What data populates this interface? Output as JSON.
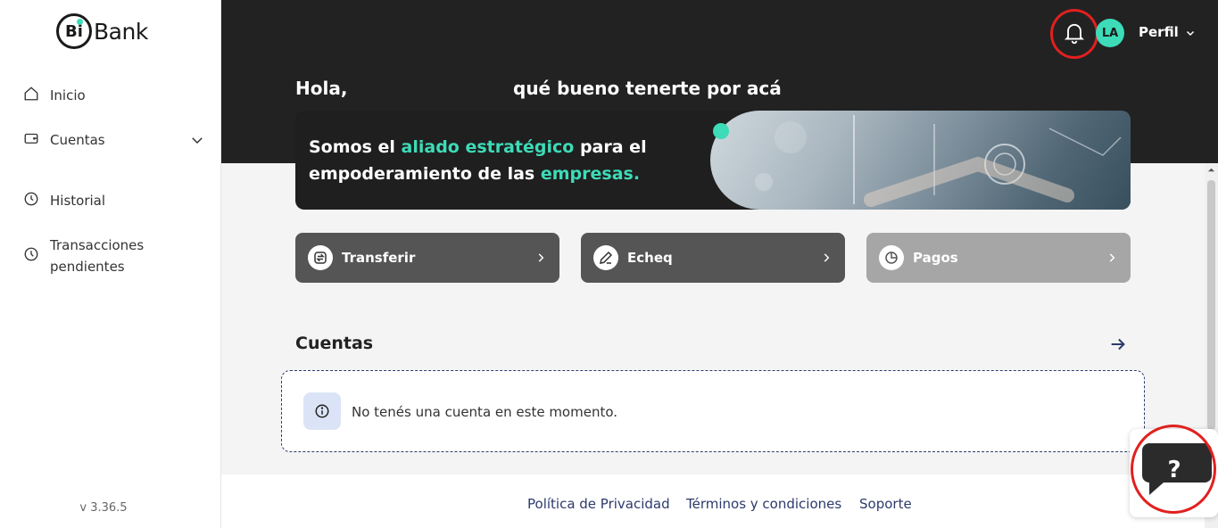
{
  "brand": {
    "logo_mark": "Bi",
    "logo_text": "Bank"
  },
  "sidebar": {
    "items": [
      {
        "label": "Inicio",
        "icon": "home-icon"
      },
      {
        "label": "Cuentas",
        "icon": "wallet-icon"
      },
      {
        "label": "Historial",
        "icon": "history-icon"
      },
      {
        "label_line1": "Transacciones",
        "label_line2": "pendientes",
        "icon": "clock-icon"
      }
    ],
    "version": "v 3.36.5"
  },
  "header": {
    "avatar_initials": "LA",
    "profile_label": "Perfil",
    "greeting_hello": "Hola,",
    "greeting_rest": "qué bueno tenerte por acá"
  },
  "banner": {
    "line1_a": "Somos el ",
    "line1_accent": "aliado estratégico",
    "line1_b": " para el",
    "line2_a": "empoderamiento de las ",
    "line2_accent": "empresas."
  },
  "actions": [
    {
      "label": "Transferir",
      "icon": "transfer-icon",
      "enabled": true
    },
    {
      "label": "Echeq",
      "icon": "pen-icon",
      "enabled": true
    },
    {
      "label": "Pagos",
      "icon": "pie-chart-icon",
      "enabled": false
    }
  ],
  "accounts": {
    "title": "Cuentas",
    "empty_message": "No tenés una cuenta en este momento."
  },
  "footer": {
    "links": [
      "Política de Privacidad",
      "Términos y condiciones",
      "Soporte"
    ]
  },
  "help": {
    "symbol": "?"
  },
  "colors": {
    "accent": "#3ddbb8",
    "header_bg": "#222222",
    "annotation_red": "#e1201f",
    "link": "#2d3a6b"
  }
}
